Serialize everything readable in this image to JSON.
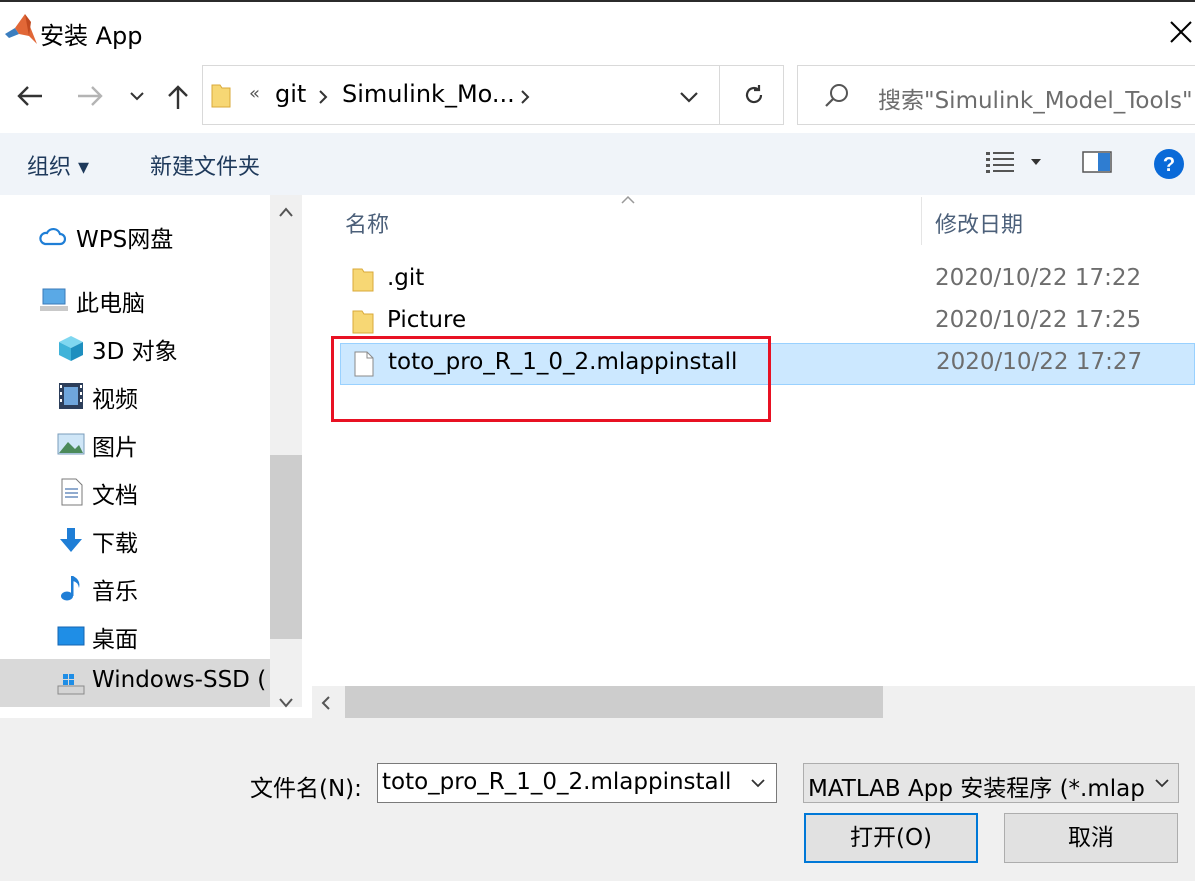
{
  "window": {
    "title": "安装 App"
  },
  "nav": {
    "path": [
      "«",
      "git",
      "Simulink_Mo..."
    ],
    "search_placeholder": "搜索\"Simulink_Model_Tools\""
  },
  "toolbar": {
    "organize": "组织 ▾",
    "new_folder": "新建文件夹"
  },
  "sidebar": {
    "items": [
      {
        "label": "WPS网盘",
        "icon": "cloud-icon"
      },
      {
        "label": "此电脑",
        "icon": "computer-icon"
      },
      {
        "label": "3D 对象",
        "icon": "cube-3d-icon"
      },
      {
        "label": "视频",
        "icon": "video-icon"
      },
      {
        "label": "图片",
        "icon": "picture-icon"
      },
      {
        "label": "文档",
        "icon": "document-icon"
      },
      {
        "label": "下载",
        "icon": "download-icon"
      },
      {
        "label": "音乐",
        "icon": "music-icon"
      },
      {
        "label": "桌面",
        "icon": "desktop-icon"
      },
      {
        "label": "Windows-SSD (",
        "icon": "drive-icon"
      }
    ]
  },
  "columns": {
    "name": "名称",
    "modified": "修改日期"
  },
  "files": [
    {
      "name": ".git",
      "date": "2020/10/22 17:22",
      "type": "folder"
    },
    {
      "name": "Picture",
      "date": "2020/10/22 17:25",
      "type": "folder"
    },
    {
      "name": "toto_pro_R_1_0_2.mlappinstall",
      "date": "2020/10/22 17:27",
      "type": "file"
    }
  ],
  "footer": {
    "filename_label": "文件名(N):",
    "filename_value": "toto_pro_R_1_0_2.mlappinstall",
    "filetype_value": "MATLAB App 安装程序 (*.mlap",
    "open": "打开(O)",
    "cancel": "取消"
  },
  "colors": {
    "selection": "#cce8ff",
    "highlight_box": "#e81123",
    "accent": "#0078d7"
  }
}
